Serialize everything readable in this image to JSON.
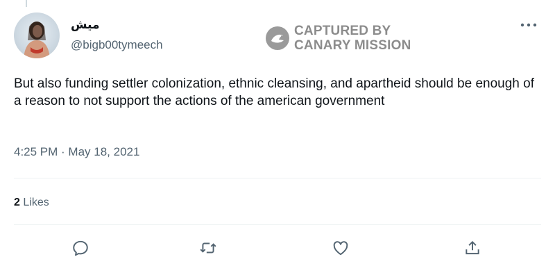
{
  "tweet": {
    "author": {
      "display_name": "ميش",
      "handle": "@bigb00tymeech",
      "avatar_icon": "profile-photo"
    },
    "watermark": {
      "line1": "CAPTURED BY",
      "line2": "CANARY MISSION",
      "logo_icon": "canary-bird-icon"
    },
    "text": "But also funding settler colonization, ethnic cleansing, and apartheid should be enough of a reason to not support the actions of the american government",
    "timestamp": "4:25 PM · May 18, 2021",
    "likes": {
      "count": "2",
      "label": "Likes"
    },
    "actions": [
      {
        "name": "reply",
        "icon": "reply-icon"
      },
      {
        "name": "retweet",
        "icon": "retweet-icon"
      },
      {
        "name": "like",
        "icon": "heart-icon"
      },
      {
        "name": "share",
        "icon": "share-icon"
      }
    ]
  },
  "colors": {
    "text": "#0f1419",
    "secondary": "#536471",
    "divider": "#eff3f4",
    "watermark": "#8c8c8c"
  }
}
